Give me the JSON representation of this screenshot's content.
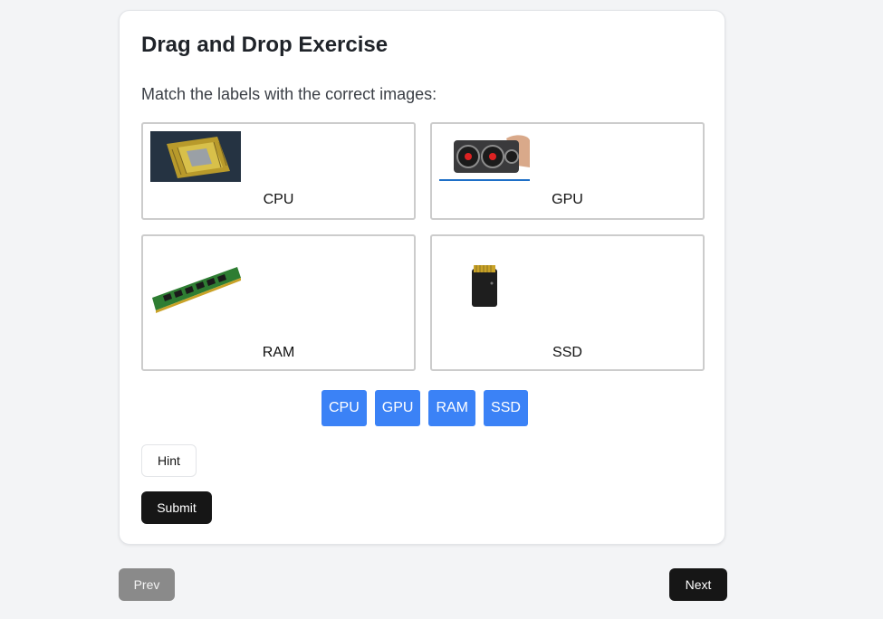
{
  "exercise": {
    "title": "Drag and Drop Exercise",
    "instruction": "Match the labels with the correct images:"
  },
  "dropzones": [
    {
      "label": "CPU",
      "image": "cpu-chip-photo"
    },
    {
      "label": "GPU",
      "image": "gpu-card-photo"
    },
    {
      "label": "RAM",
      "image": "ram-stick-photo"
    },
    {
      "label": "SSD",
      "image": "ssd-module-photo"
    }
  ],
  "draggables": [
    "CPU",
    "GPU",
    "RAM",
    "SSD"
  ],
  "buttons": {
    "hint": "Hint",
    "submit": "Submit",
    "prev": "Prev",
    "next": "Next"
  },
  "colors": {
    "chip": "#3b82f6",
    "primary_button": "#161616",
    "disabled_button": "#8a8a8a",
    "background": "#f3f4f6"
  }
}
